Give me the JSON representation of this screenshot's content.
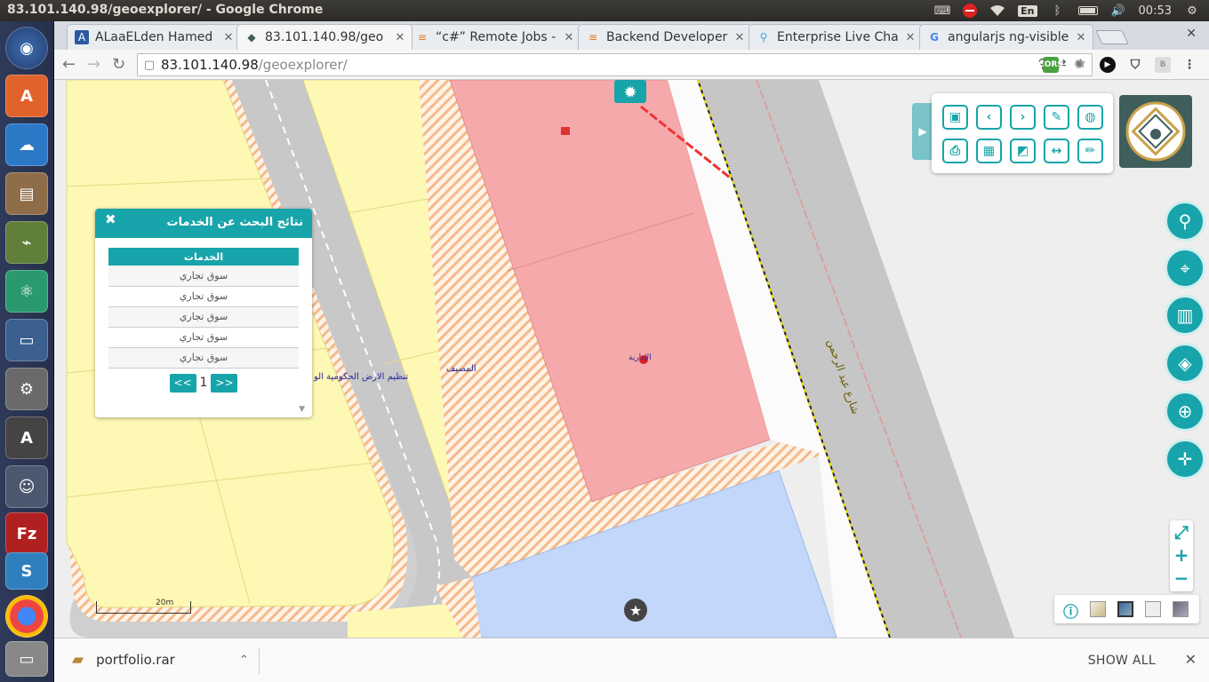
{
  "window": {
    "title": "83.101.140.98/geoexplorer/ - Google Chrome"
  },
  "tray": {
    "keyboard_layout": "En",
    "clock": "00:53"
  },
  "launcher": [
    "ubuntu-dash-icon",
    "software-updater-icon",
    "cloud-icon",
    "file-manager-icon",
    "network-tool-icon",
    "atom-editor-icon",
    "remote-desktop-icon",
    "system-settings-icon",
    "installer-icon",
    "user-accounts-icon",
    "filezilla-icon",
    "app-stack-icon",
    "chrome-icon",
    "drive-icon"
  ],
  "tabs": [
    {
      "label": "ALaaELden Hamed",
      "fav": "A"
    },
    {
      "label": "83.101.140.98/geo",
      "fav": "◆"
    },
    {
      "label": "“c#” Remote Jobs -",
      "fav": "≡"
    },
    {
      "label": "Backend Developer",
      "fav": "≡"
    },
    {
      "label": "Enterprise Live Cha",
      "fav": "⚲"
    },
    {
      "label": "angularjs ng-visible",
      "fav": "G"
    }
  ],
  "address": {
    "host": "83.101.140.98",
    "path": "/geoexplorer/"
  },
  "results": {
    "title": "نتائج البحث عن الخدمات",
    "column": "الخدمات",
    "rows": [
      "سوق تجاري",
      "سوق تجاري",
      "سوق تجاري",
      "سوق تجاري",
      "سوق تجاري"
    ],
    "page": "1",
    "prev_label": "<<",
    "next_label": ">>"
  },
  "map_labels": {
    "street": "شارع عبد الرحمن",
    "parcel_left": "تنظيم الارض الحكومية الو",
    "parcel_mid": "المصيف",
    "parcel_pink": "الإدارية"
  },
  "scale": {
    "label": "20m"
  },
  "downloads": {
    "file": "portfolio.rar",
    "show_all": "SHOW ALL"
  }
}
